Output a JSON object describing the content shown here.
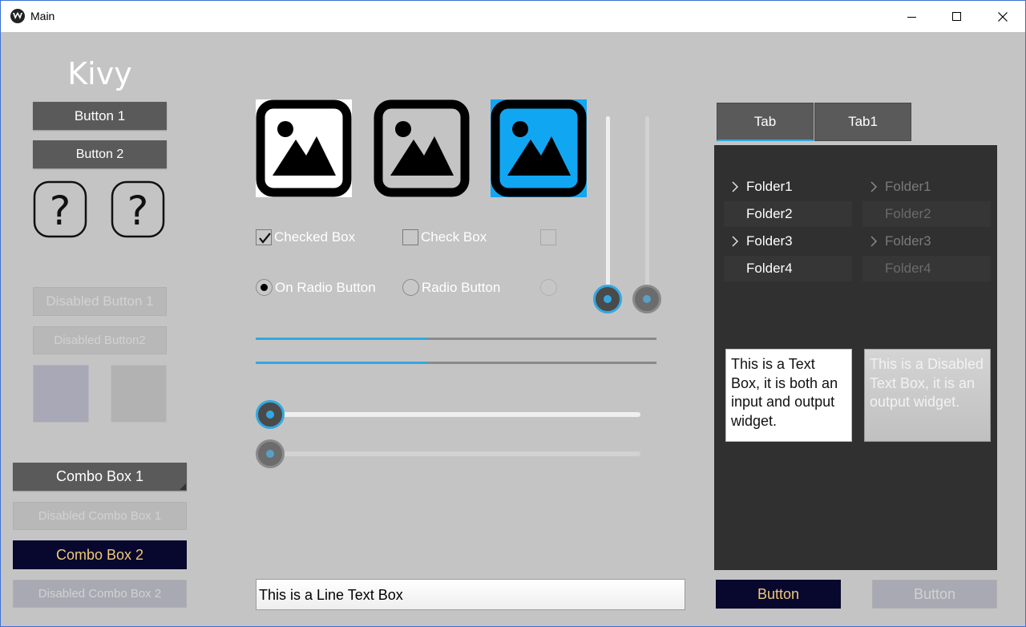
{
  "window": {
    "title": "Main",
    "app_icon": "kivy-logo-icon",
    "controls": [
      "minimize-icon",
      "maximize-icon",
      "close-icon"
    ]
  },
  "left": {
    "heading": "Kivy",
    "button1": "Button 1",
    "button2": "Button 2",
    "help_icons": [
      "question-icon",
      "question-icon"
    ],
    "disabled_button1": "Disabled Button 1",
    "disabled_button2": "Disabled Button2",
    "combo1": "Combo Box 1",
    "disabled_combo1": "Disabled Combo Box 1",
    "combo2": "Combo Box 2",
    "disabled_combo2": "Disabled Combo Box 2"
  },
  "middle": {
    "image_icons": [
      "image-icon",
      "image-icon",
      "image-icon"
    ],
    "checked_box": "Checked Box",
    "check_box": "Check Box",
    "on_radio": "On Radio Button",
    "radio": "Radio Button",
    "progress1": 0.43,
    "progress2": 0.43,
    "slider1": 0.0,
    "slider2": 0.0,
    "vslider1": 0.0,
    "vslider2": 0.0,
    "line_text": "This is a Line Text Box"
  },
  "right": {
    "tabs": [
      "Tab",
      "Tab1"
    ],
    "tree": [
      {
        "label": "Folder1",
        "expandable": true
      },
      {
        "label": "Folder2",
        "expandable": false
      },
      {
        "label": "Folder3",
        "expandable": true
      },
      {
        "label": "Folder4",
        "expandable": false
      }
    ],
    "tree_disabled": [
      {
        "label": "Folder1",
        "expandable": true
      },
      {
        "label": "Folder2",
        "expandable": false
      },
      {
        "label": "Folder3",
        "expandable": true
      },
      {
        "label": "Folder4",
        "expandable": false
      }
    ],
    "text_box": "This is a Text Box, it is both an input and output widget.",
    "disabled_text_box": "This is a Disabled Text Box, it is an output widget.",
    "button": "Button",
    "disabled_button": "Button"
  },
  "colors": {
    "accent": "#33a8e0",
    "background": "#c4c4c4",
    "dark_button": "#5a5a5a",
    "navy_button": "#08082e",
    "gold_text": "#f0c878",
    "panel": "#303030"
  }
}
